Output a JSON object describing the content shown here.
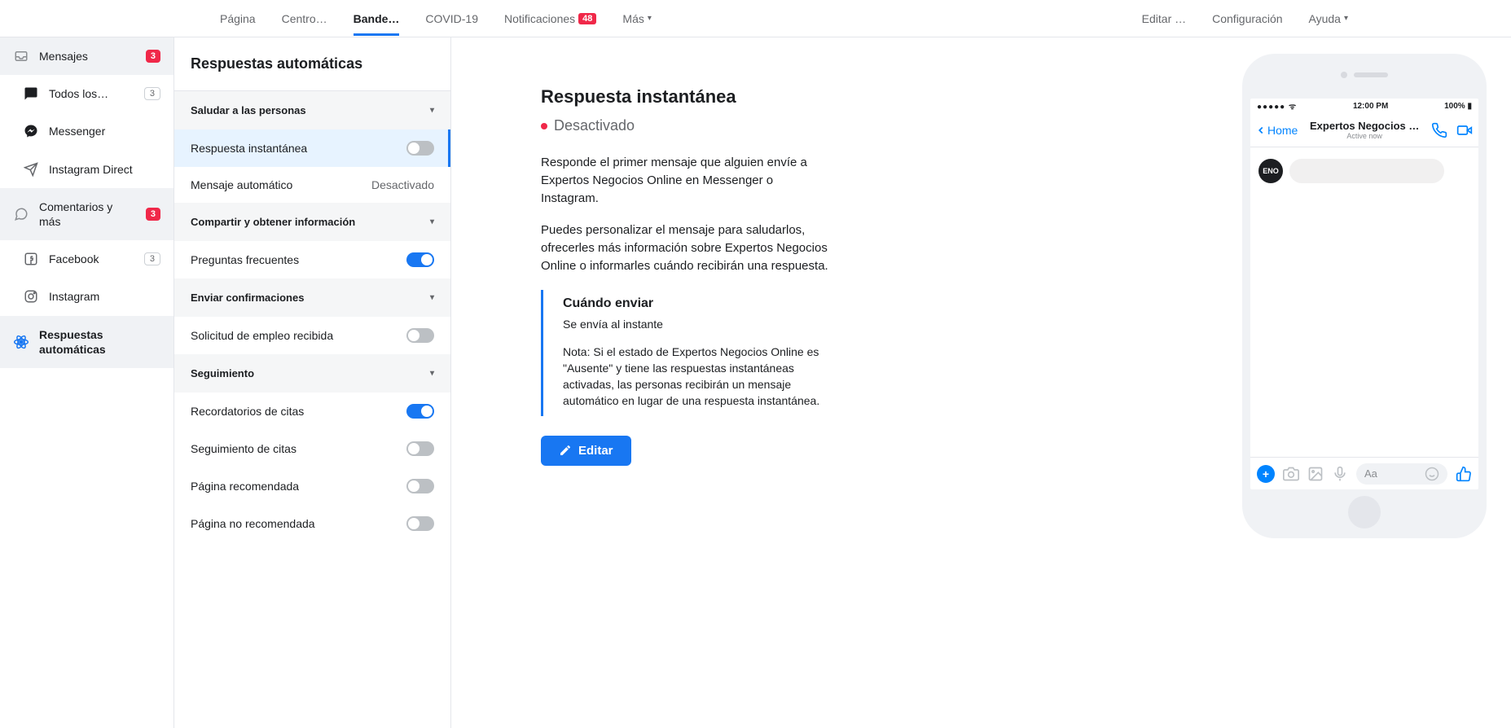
{
  "topnav": {
    "left": [
      "Página",
      "Centro…",
      "Bande…",
      "COVID-19",
      "Notificaciones",
      "Más"
    ],
    "notifications_badge": "48",
    "right": [
      "Editar …",
      "Configuración",
      "Ayuda"
    ],
    "active_index": 2
  },
  "sidebar": {
    "items": [
      {
        "label": "Mensajes",
        "badge_red": "3"
      },
      {
        "label": "Todos los…",
        "badge_grey": "3",
        "sub": true
      },
      {
        "label": "Messenger",
        "sub": true
      },
      {
        "label": "Instagram Direct",
        "sub": true
      },
      {
        "label": "Comentarios y más",
        "badge_red": "3"
      },
      {
        "label": "Facebook",
        "badge_grey": "3",
        "sub": true
      },
      {
        "label": "Instagram",
        "sub": true
      },
      {
        "label": "Respuestas automáticas",
        "selected": true
      }
    ]
  },
  "mid": {
    "title": "Respuestas automáticas",
    "groups": {
      "greet": "Saludar a las personas",
      "share": "Compartir y obtener información",
      "confirm": "Enviar confirmaciones",
      "follow": "Seguimiento"
    },
    "rows": {
      "instant": {
        "label": "Respuesta instantánea",
        "on": false,
        "highlight": true
      },
      "away": {
        "label": "Mensaje automático",
        "status": "Desactivado"
      },
      "faq": {
        "label": "Preguntas frecuentes",
        "on": true
      },
      "job": {
        "label": "Solicitud de empleo recibida",
        "on": false
      },
      "remind": {
        "label": "Recordatorios de citas",
        "on": true
      },
      "followapt": {
        "label": "Seguimiento de citas",
        "on": false
      },
      "pagerec": {
        "label": "Página recomendada",
        "on": false
      },
      "pagenorec": {
        "label": "Página no recomendada",
        "on": false
      }
    }
  },
  "detail": {
    "title": "Respuesta instantánea",
    "status": "Desactivado",
    "p1": "Responde el primer mensaje que alguien envíe a Expertos Negocios Online en Messenger o Instagram.",
    "p2": "Puedes personalizar el mensaje para saludarlos, ofrecerles más información sobre Expertos Negocios Online o informarles cuándo recibirán una respuesta.",
    "when_title": "Cuándo enviar",
    "when_sub": "Se envía al instante",
    "when_note": "Nota: Si el estado de Expertos Negocios Online es \"Ausente\" y tiene las respuestas instantáneas activadas, las personas recibirán un mensaje automático en lugar de una respuesta instantánea.",
    "edit_btn": "Editar"
  },
  "preview": {
    "time": "12:00 PM",
    "battery": "100%",
    "home": "Home",
    "page_name": "Expertos Negocios …",
    "active": "Active now",
    "input_placeholder": "Aa",
    "avatar_text": "ENO"
  }
}
